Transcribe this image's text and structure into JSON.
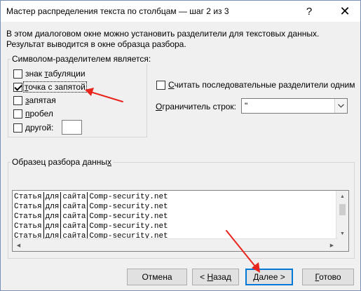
{
  "window": {
    "title": "Мастер распределения текста по столбцам — шаг 2 из 3",
    "help_glyph": "?",
    "close_glyph": "✕"
  },
  "description": "В этом диалоговом окне можно установить разделители для текстовых данных. Результат выводится в окне образца разбора.",
  "delimiters": {
    "legend": "Символом-разделителем является:",
    "items": [
      {
        "label_pre": "знак ",
        "label_u": "т",
        "label_post": "абуляции",
        "checked": false
      },
      {
        "label_pre": "",
        "label_u": "т",
        "label_post": "очка с запятой",
        "checked": true
      },
      {
        "label_pre": "",
        "label_u": "з",
        "label_post": "апятая",
        "checked": false
      },
      {
        "label_pre": "",
        "label_u": "п",
        "label_post": "робел",
        "checked": false
      },
      {
        "label_pre": "",
        "label_u": "д",
        "label_post": "ругой:",
        "checked": false
      }
    ],
    "other_value": ""
  },
  "consecutive": {
    "label_pre": "",
    "label_u": "С",
    "label_post": "читать последовательные разделители одним",
    "checked": false
  },
  "text_qualifier": {
    "label_pre": "",
    "label_u": "О",
    "label_post": "граничитель строк:",
    "value": "\""
  },
  "preview": {
    "legend_pre": "Образец разбора данны",
    "legend_u": "х",
    "rows": [
      [
        "Статья",
        "для",
        "сайта",
        "Comp-security.net"
      ],
      [
        "Статья",
        "для",
        "сайта",
        "Comp-security.net"
      ],
      [
        "Статья",
        "для",
        "сайта",
        "Comp-security.net"
      ],
      [
        "Статья",
        "для",
        "сайта",
        "Comp-security.net"
      ],
      [
        "Статья",
        "для",
        "сайта",
        "Comp-security.net"
      ]
    ]
  },
  "buttons": {
    "cancel": {
      "pre": "Отмена",
      "u": "",
      "post": ""
    },
    "back": {
      "pre": "< ",
      "u": "Н",
      "post": "азад"
    },
    "next": {
      "pre": "",
      "u": "Д",
      "post": "алее >"
    },
    "finish": {
      "pre": "",
      "u": "Г",
      "post": "отово"
    }
  },
  "colors": {
    "annotation_arrow": "#e8241c",
    "default_button_border": "#0078d7"
  }
}
